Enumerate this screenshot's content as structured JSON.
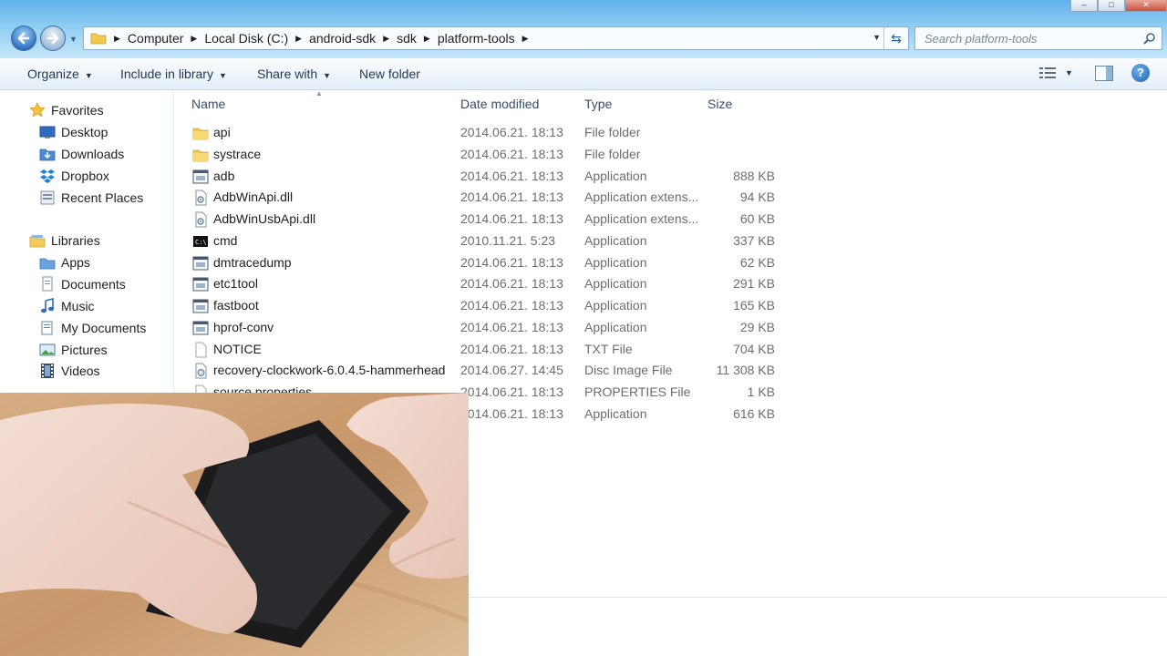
{
  "window": {
    "controls": [
      "–",
      "□",
      "✕"
    ]
  },
  "address": {
    "crumbs": [
      "Computer",
      "Local Disk (C:)",
      "android-sdk",
      "sdk",
      "platform-tools"
    ]
  },
  "search": {
    "placeholder": "Search platform-tools"
  },
  "toolbar": {
    "organize": "Organize",
    "include": "Include in library",
    "share": "Share with",
    "new_folder": "New folder"
  },
  "nav": {
    "favorites": {
      "title": "Favorites",
      "items": [
        "Desktop",
        "Downloads",
        "Dropbox",
        "Recent Places"
      ]
    },
    "libraries": {
      "title": "Libraries",
      "items": [
        "Apps",
        "Documents",
        "Music",
        "My Documents",
        "Pictures",
        "Videos"
      ]
    }
  },
  "columns": {
    "name": "Name",
    "date": "Date modified",
    "type": "Type",
    "size": "Size"
  },
  "files": [
    {
      "name": "api",
      "date": "2014.06.21. 18:13",
      "type": "File folder",
      "size": "",
      "icon": "folder-icon"
    },
    {
      "name": "systrace",
      "date": "2014.06.21. 18:13",
      "type": "File folder",
      "size": "",
      "icon": "folder-icon"
    },
    {
      "name": "adb",
      "date": "2014.06.21. 18:13",
      "type": "Application",
      "size": "888 KB",
      "icon": "application-icon"
    },
    {
      "name": "AdbWinApi.dll",
      "date": "2014.06.21. 18:13",
      "type": "Application extens...",
      "size": "94 KB",
      "icon": "dll-icon"
    },
    {
      "name": "AdbWinUsbApi.dll",
      "date": "2014.06.21. 18:13",
      "type": "Application extens...",
      "size": "60 KB",
      "icon": "dll-icon"
    },
    {
      "name": "cmd",
      "date": "2010.11.21. 5:23",
      "type": "Application",
      "size": "337 KB",
      "icon": "cmd-icon"
    },
    {
      "name": "dmtracedump",
      "date": "2014.06.21. 18:13",
      "type": "Application",
      "size": "62 KB",
      "icon": "application-icon"
    },
    {
      "name": "etc1tool",
      "date": "2014.06.21. 18:13",
      "type": "Application",
      "size": "291 KB",
      "icon": "application-icon"
    },
    {
      "name": "fastboot",
      "date": "2014.06.21. 18:13",
      "type": "Application",
      "size": "165 KB",
      "icon": "application-icon"
    },
    {
      "name": "hprof-conv",
      "date": "2014.06.21. 18:13",
      "type": "Application",
      "size": "29 KB",
      "icon": "application-icon"
    },
    {
      "name": "NOTICE",
      "date": "2014.06.21. 18:13",
      "type": "TXT File",
      "size": "704 KB",
      "icon": "text-file-icon"
    },
    {
      "name": "recovery-clockwork-6.0.4.5-hammerhead",
      "date": "2014.06.27. 14:45",
      "type": "Disc Image File",
      "size": "11 308 KB",
      "icon": "disc-image-icon"
    },
    {
      "name": "source.properties",
      "date": "2014.06.21. 18:13",
      "type": "PROPERTIES File",
      "size": "1 KB",
      "icon": "text-file-icon"
    },
    {
      "name": "",
      "date": "2014.06.21. 18:13",
      "type": "Application",
      "size": "616 KB",
      "icon": "application-icon"
    }
  ]
}
